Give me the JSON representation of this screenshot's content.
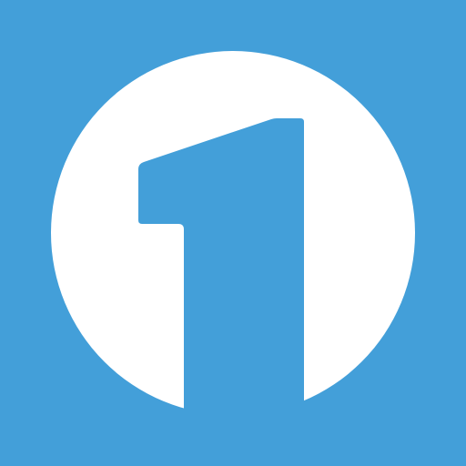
{
  "icon": {
    "name": "number-one-logo-icon",
    "background_color": "#439FD9",
    "circle_color": "#FFFFFF",
    "glyph_color": "#439FD9"
  }
}
